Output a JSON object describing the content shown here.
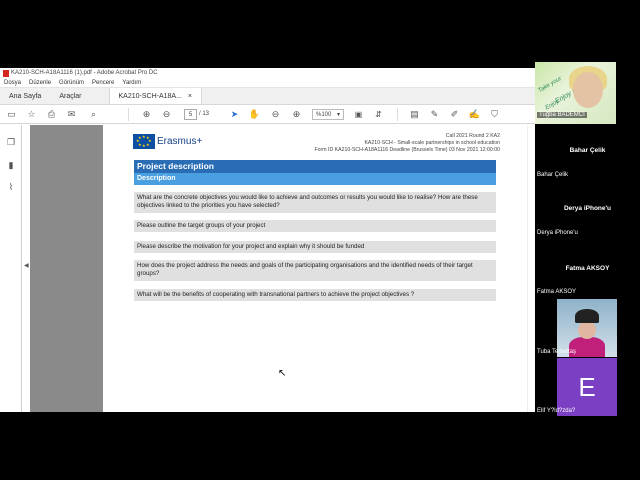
{
  "window": {
    "title": "KA210-SCH-A18A1116 (1).pdf - Adobe Acrobat Pro DC",
    "menu": [
      "Dosya",
      "Düzenle",
      "Görünüm",
      "Pencere",
      "Yardım"
    ]
  },
  "tabs": {
    "home": "Ana Sayfa",
    "tools": "Araçlar",
    "doc": "KA210-SCH-A18A...",
    "close": "×"
  },
  "toolbar": {
    "page_current": "5",
    "page_total": "/ 13",
    "zoom": "%100"
  },
  "document": {
    "logo_text": "Erasmus+",
    "header_lines": [
      "Call 2021 Round 2 KA2",
      "KA210-SCH - Small-scale partnerships in school education",
      "Form ID KA210-SCH-A18A1116 Deadline (Brussels Time) 03 Nov 2021 12:00:00"
    ],
    "section_title": "Project description",
    "section_subtitle": "Description",
    "questions": [
      "What are the concrete objectives you would like to achieve and outcomes or results you would like to realise? How are these objectives linked to the priorities you have selected?",
      "Please outline the target groups of your project",
      "Please describe the motivation for your project and explain why it should be funded",
      "How does the project address the needs and goals of the participating organisations and the identified needs of their target groups?",
      "What will be the benefits of cooperating with transnational partners to achieve the project objectives ?"
    ]
  },
  "participants": [
    {
      "name": "Tuğba BADEMCI",
      "label": "Tuğba BADEMCİ"
    },
    {
      "name": "Bahar Çelik",
      "label": "Bahar Çelik"
    },
    {
      "name": "Derya iPhone'u",
      "label": "Derya iPhone'u"
    },
    {
      "name": "Fatma AKSOY",
      "label": "Fatma AKSOY"
    },
    {
      "name": "Tuba Temeltaş",
      "label": "Tuba Temeltaş"
    },
    {
      "name": "Elif Y?ld?zda?",
      "label": "Elif Y?ld?zda?",
      "initial": "E"
    }
  ],
  "cam_overlay_text": [
    "Take your",
    "Enjoy English",
    "Enjoy"
  ]
}
